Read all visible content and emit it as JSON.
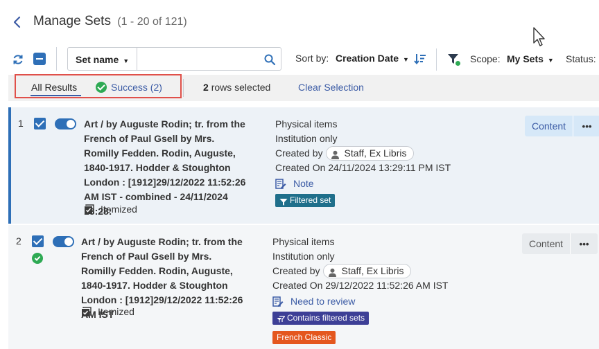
{
  "header": {
    "title": "Manage Sets",
    "count": "(1 - 20 of 121)",
    "back_icon": "chevron-left-icon"
  },
  "toolbar": {
    "search_type": "Set name",
    "search_value": "",
    "sort_label": "Sort by:",
    "sort_value": "Creation Date",
    "scope_label": "Scope:",
    "scope_value": "My Sets",
    "status_label": "Status:"
  },
  "tabs": {
    "all_label": "All Results",
    "success_label": "Success (2)"
  },
  "selection": {
    "count": "2",
    "text": "rows selected",
    "clear_label": "Clear Selection"
  },
  "rows": [
    {
      "index": "1",
      "title": "Art / by Auguste Rodin; tr. from the French of Paul Gsell by Mrs. Romilly Fedden. Rodin, Auguste, 1840-1917. Hodder & Stoughton London : [1912]29/12/2022 11:52:26 AM IST - combined - 24/11/2024 13:28:",
      "itemized": "Itemized",
      "content_type": "Physical items",
      "privacy": "Institution only",
      "created_by_label": "Created by",
      "created_by": "Staff, Ex Libris",
      "created_on_label": "Created On",
      "created_on": "24/11/2024 13:29:11 PM IST",
      "note": "Note",
      "tags": [
        "Filtered set"
      ],
      "content_button": "Content",
      "selected": true,
      "active": true,
      "success": false
    },
    {
      "index": "2",
      "title": "Art / by Auguste Rodin; tr. from the French of Paul Gsell by Mrs. Romilly Fedden. Rodin, Auguste, 1840-1917. Hodder & Stoughton London : [1912]29/12/2022 11:52:26 AM IST",
      "itemized": "Itemized",
      "content_type": "Physical items",
      "privacy": "Institution only",
      "created_by_label": "Created by",
      "created_by": "Staff, Ex Libris",
      "created_on_label": "Created On",
      "created_on": "29/12/2022 11:52:26 AM IST",
      "note": "Need to review",
      "tags": [
        "Contains filtered sets",
        "French Classic"
      ],
      "content_button": "Content",
      "selected": true,
      "active": true,
      "success": true
    }
  ],
  "colors": {
    "accent": "#2e6fb7",
    "link": "#3b5ba5",
    "success": "#2eaa54",
    "highlight": "#e0504a",
    "tag_filtered": "#1f6f8b",
    "tag_contains": "#3d3f96",
    "tag_french": "#e4571e"
  }
}
